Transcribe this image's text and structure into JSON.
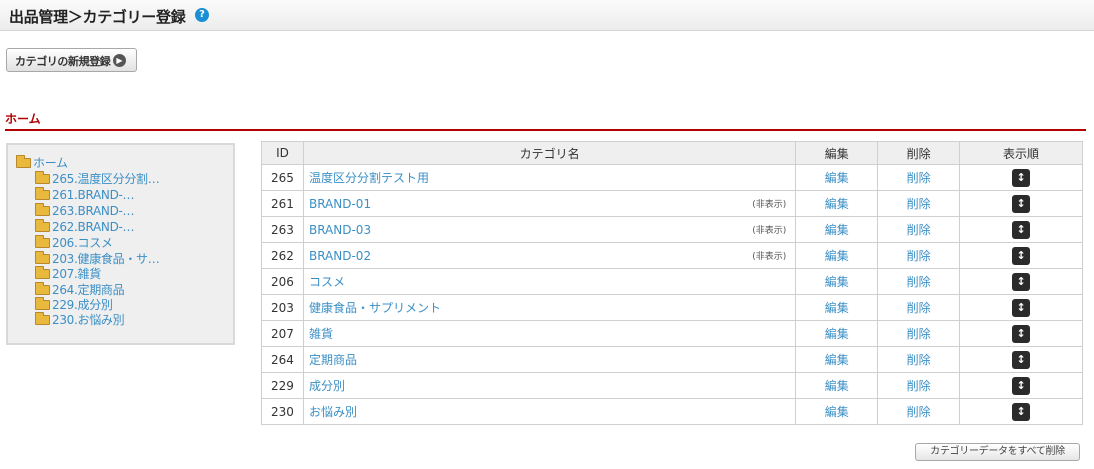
{
  "header": {
    "title": "出品管理＞カテゴリー登録",
    "help_icon": "question-circle-icon"
  },
  "actions": {
    "new_category": "カテゴリの新規登録",
    "new_category_icon": "arrow-right-circle-icon",
    "delete_all": "カテゴリーデータをすべて削除"
  },
  "breadcrumb": {
    "home": "ホーム"
  },
  "colors": {
    "accent": "#b30000",
    "link": "#3b8fc6",
    "help": "#1a8fd6"
  },
  "tree": {
    "root": "ホーム",
    "items": [
      "265.温度区分分割…",
      "261.BRAND-…",
      "263.BRAND-…",
      "262.BRAND-…",
      "206.コスメ",
      "203.健康食品・サ…",
      "207.雑貨",
      "264.定期商品",
      "229.成分別",
      "230.お悩み別"
    ]
  },
  "table": {
    "headers": {
      "id": "ID",
      "name": "カテゴリ名",
      "edit": "編集",
      "delete": "削除",
      "order": "表示順"
    },
    "rows": [
      {
        "id": "265",
        "name": "温度区分分割テスト用",
        "status": "",
        "edit": "編集",
        "delete": "削除"
      },
      {
        "id": "261",
        "name": "BRAND-01",
        "status": "(非表示)",
        "edit": "編集",
        "delete": "削除"
      },
      {
        "id": "263",
        "name": "BRAND-03",
        "status": "(非表示)",
        "edit": "編集",
        "delete": "削除"
      },
      {
        "id": "262",
        "name": "BRAND-02",
        "status": "(非表示)",
        "edit": "編集",
        "delete": "削除"
      },
      {
        "id": "206",
        "name": "コスメ",
        "status": "",
        "edit": "編集",
        "delete": "削除"
      },
      {
        "id": "203",
        "name": "健康食品・サプリメント",
        "status": "",
        "edit": "編集",
        "delete": "削除"
      },
      {
        "id": "207",
        "name": "雑貨",
        "status": "",
        "edit": "編集",
        "delete": "削除"
      },
      {
        "id": "264",
        "name": "定期商品",
        "status": "",
        "edit": "編集",
        "delete": "削除"
      },
      {
        "id": "229",
        "name": "成分別",
        "status": "",
        "edit": "編集",
        "delete": "削除"
      },
      {
        "id": "230",
        "name": "お悩み別",
        "status": "",
        "edit": "編集",
        "delete": "削除"
      }
    ],
    "sort_icon": "updown-arrow-icon"
  }
}
